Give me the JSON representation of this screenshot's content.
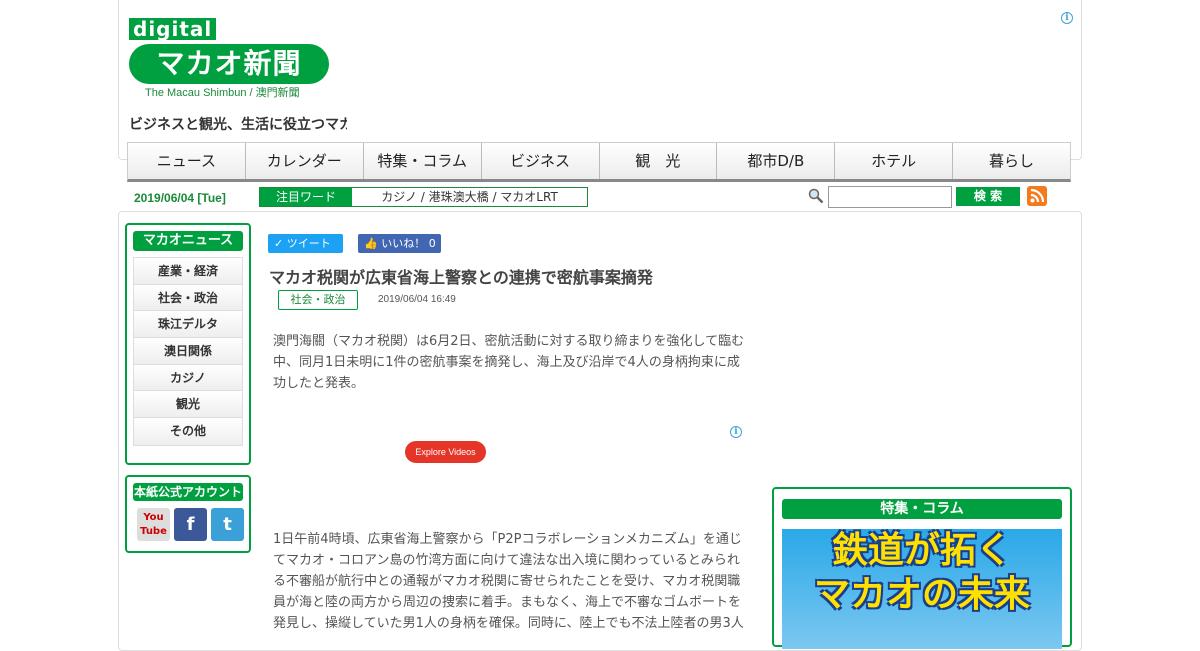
{
  "header": {
    "logo_digital": "digital",
    "logo_main": "マカオ新聞",
    "logo_sub": "The Macau Shimbun / 澳門新聞",
    "tagline": "ビジネスと観光、生活に役立つマカ",
    "adchoice": "i"
  },
  "nav": [
    "ニュース",
    "カレンダー",
    "特集・コラム",
    "ビジネス",
    "観　光",
    "都市D/B",
    "ホテル",
    "暮らし"
  ],
  "date": "2019/06/04 [Tue]",
  "hot_words": {
    "label": "注目ワード",
    "text": "カジノ / 港珠澳大橋 / マカオLRT"
  },
  "search": {
    "placeholder": "",
    "button": "検 索"
  },
  "sidebar": {
    "title": "マカオニュース",
    "items": [
      "産業・経済",
      "社会・政治",
      "珠江デルタ",
      "澳日関係",
      "カジノ",
      "観光",
      "その他"
    ]
  },
  "accounts": {
    "title": "本紙公式アカウント",
    "youtube": "You Tube",
    "facebook": "f",
    "twitter": "t"
  },
  "share": {
    "tweet": "ツイート",
    "like": "いいね！ 0"
  },
  "article": {
    "title": "マカオ税関が広東省海上警察との連携で密航事案摘発",
    "category": "社会・政治",
    "date": "2019/06/04 16:49",
    "para1": "澳門海關（マカオ税関）は6月2日、密航活動に対する取り締まりを強化して臨む中、同月1日未明に1件の密航事案を摘発し、海上及び沿岸で4人の身柄拘束に成功したと発表。",
    "para2": "1日午前4時頃、広東省海上警察から「P2Pコラボレーションメカニズム」を通じてマカオ・コロアン島の竹湾方面に向けて違法な出入境に関わっているとみられる不審船が航行中との通報がマカオ税関に寄せられたことを受け、マカオ税関職員が海と陸の両方から周辺の捜索に着手。まもなく、海上で不審なゴムボートを発見し、操縦していた男1人の身柄を確保。同時に、陸上でも不法上陸者の男3人"
  },
  "video": {
    "button": "Explore Videos"
  },
  "feature": {
    "title": "特集・コラム",
    "line1": "鉄道が拓く",
    "line2": "マカオの未来"
  },
  "colors": {
    "brand_green": "#00a040",
    "tweet_blue": "#1da1f2",
    "fb_blue": "#4267b2",
    "explore_red": "#e53528"
  }
}
